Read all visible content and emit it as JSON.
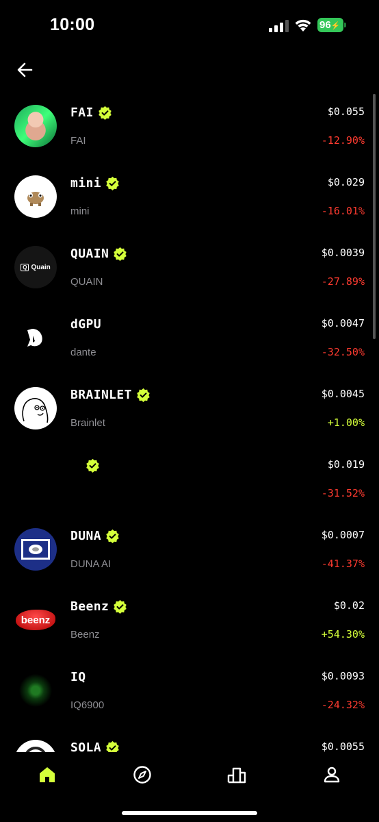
{
  "status_bar": {
    "time": "10:00",
    "battery": "96"
  },
  "colors": {
    "accent": "#d4ff3a",
    "negative": "#ff3b30",
    "positive": "#d4ff3a",
    "muted": "#8e8e93"
  },
  "tokens": [
    {
      "name": "FAI",
      "subname": "FAI",
      "price": "$0.055",
      "change": "-12.90%",
      "trend": "negative",
      "verified": true,
      "avatar": "green-hair-woman"
    },
    {
      "name": "mini",
      "subname": "mini",
      "price": "$0.029",
      "change": "-16.01%",
      "trend": "negative",
      "verified": true,
      "avatar": "mini-creature"
    },
    {
      "name": "QUAIN",
      "subname": "QUAIN",
      "price": "$0.0039",
      "change": "-27.89%",
      "trend": "negative",
      "verified": true,
      "avatar": "quain-logo",
      "avatar_text": "Quain"
    },
    {
      "name": "dGPU",
      "subname": "dante",
      "price": "$0.0047",
      "change": "-32.50%",
      "trend": "negative",
      "verified": false,
      "avatar": "dante-logo"
    },
    {
      "name": "BRAINLET",
      "subname": "Brainlet",
      "price": "$0.0045",
      "change": "+1.00%",
      "trend": "positive",
      "verified": true,
      "avatar": "brainlet-face"
    },
    {
      "name": "",
      "subname": "",
      "price": "$0.019",
      "change": "-31.52%",
      "trend": "negative",
      "verified": true,
      "avatar": "none"
    },
    {
      "name": "DUNA",
      "subname": "DUNA AI",
      "price": "$0.0007",
      "change": "-41.37%",
      "trend": "negative",
      "verified": true,
      "avatar": "wyoming-flag"
    },
    {
      "name": "Beenz",
      "subname": "Beenz",
      "price": "$0.02",
      "change": "+54.30%",
      "trend": "positive",
      "verified": true,
      "avatar": "beenz-bean",
      "avatar_text": "beenz"
    },
    {
      "name": "IQ",
      "subname": "IQ6900",
      "price": "$0.0093",
      "change": "-24.32%",
      "trend": "negative",
      "verified": false,
      "avatar": "iq-green-orb"
    },
    {
      "name": "SOLA",
      "subname": "",
      "price": "$0.0055",
      "change": "",
      "trend": "negative",
      "verified": true,
      "avatar": "sola-logo"
    }
  ],
  "tab_bar": [
    {
      "icon": "home-icon",
      "active": true
    },
    {
      "icon": "compass-icon",
      "active": false
    },
    {
      "icon": "leaderboard-icon",
      "active": false
    },
    {
      "icon": "profile-icon",
      "active": false
    }
  ]
}
